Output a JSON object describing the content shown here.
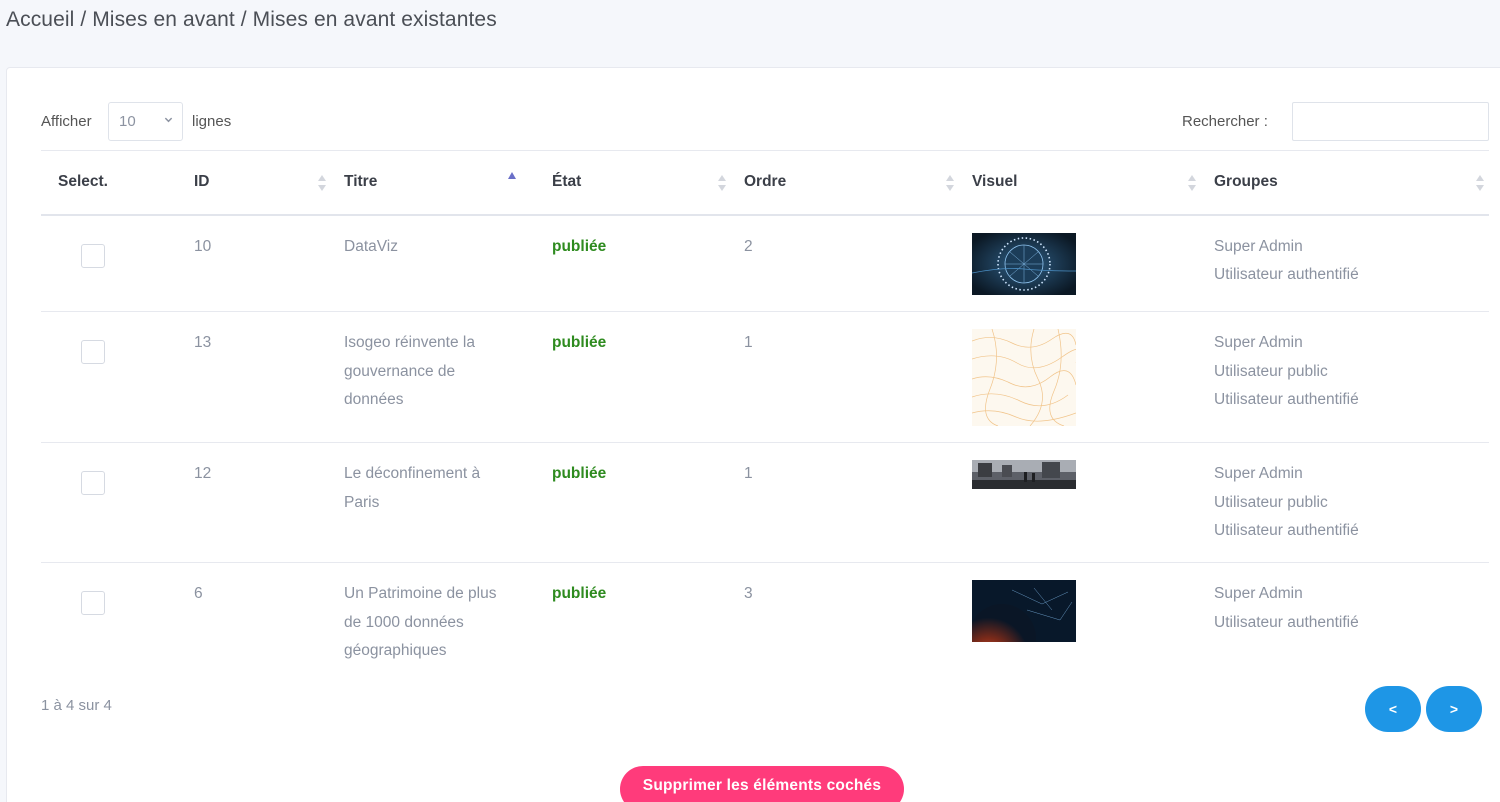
{
  "breadcrumb": {
    "home": "Accueil",
    "sep1": " / ",
    "section": "Mises en avant",
    "sep2": " / ",
    "current": "Mises en avant existantes"
  },
  "controls": {
    "show_label": "Afficher",
    "page_size": "10",
    "lines_label": "lignes",
    "search_label": "Rechercher :",
    "search_value": ""
  },
  "table": {
    "headers": [
      "Select.",
      "ID",
      "Titre",
      "État",
      "Ordre",
      "Visuel",
      "Groupes"
    ],
    "sorted_column": "Titre",
    "sort_direction": "ascending",
    "rows": [
      {
        "id": "10",
        "title": [
          "DataViz"
        ],
        "state": "publiée",
        "order": "2",
        "visual": "dataviz-globe-thumbnail",
        "groups": [
          "Super Admin",
          "Utilisateur authentifié"
        ],
        "checked": false
      },
      {
        "id": "13",
        "title": [
          "Isogeo réinvente la",
          "gouvernance de",
          "données"
        ],
        "state": "publiée",
        "order": "1",
        "visual": "contour-map-thumbnail",
        "groups": [
          "Super Admin",
          "Utilisateur public",
          "Utilisateur authentifié"
        ],
        "checked": false
      },
      {
        "id": "12",
        "title": [
          "Le déconfinement à",
          "Paris"
        ],
        "state": "publiée",
        "order": "1",
        "visual": "paris-street-thumbnail",
        "groups": [
          "Super Admin",
          "Utilisateur public",
          "Utilisateur authentifié"
        ],
        "checked": false
      },
      {
        "id": "6",
        "title": [
          "Un Patrimoine de plus",
          "de 1000 données",
          "géographiques"
        ],
        "state": "publiée",
        "order": "3",
        "visual": "earth-network-thumbnail",
        "groups": [
          "Super Admin",
          "Utilisateur authentifié"
        ],
        "checked": false
      }
    ]
  },
  "pagination": {
    "info": "1 à 4 sur 4",
    "prev_label": "<",
    "next_label": ">"
  },
  "actions": {
    "delete_label": "Supprimer les éléments cochés"
  },
  "colors": {
    "accent_blue": "#1e96e6",
    "delete_pink": "#ff3b7b",
    "published_green": "#2e8b1f"
  }
}
